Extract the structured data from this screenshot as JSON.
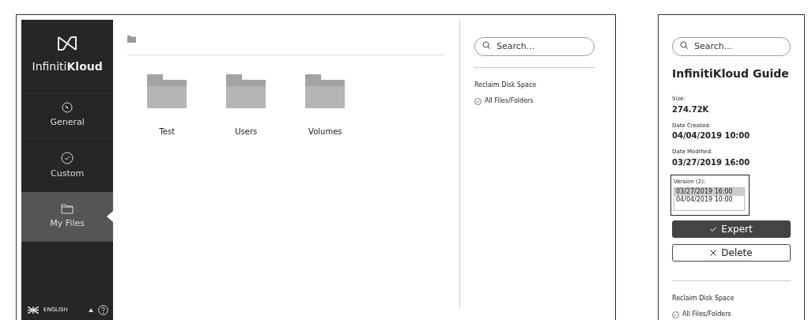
{
  "sidebar": {
    "brand": "Infiniti**Kloud**",
    "items": [
      {
        "label": "General",
        "selected": false
      },
      {
        "label": "Custom",
        "selected": false
      },
      {
        "label": "My Files",
        "selected": true
      }
    ],
    "language": "ENGLISH"
  },
  "folders": [
    {
      "name": "Test"
    },
    {
      "name": "Users"
    },
    {
      "name": "Volumes"
    }
  ],
  "side_panel": {
    "search": {
      "placeholder": "Search..."
    },
    "section": "Reclaim Disk Space",
    "option": "All Files/Folders"
  },
  "detail_panel": {
    "search": {
      "placeholder": "Search..."
    },
    "title": "InfinitiKloud Guide",
    "fields": [
      {
        "label": "Size:",
        "value": "274.72K"
      },
      {
        "label": "Date Created:",
        "value": "04/04/2019 10:00"
      },
      {
        "label": "Date Modified:",
        "value": "03/27/2019 16:00"
      }
    ],
    "versions_label": "Version (2):",
    "versions": [
      {
        "text": "03/27/2019 16:00",
        "selected": true
      },
      {
        "text": "04/04/2019 10:00",
        "selected": false
      }
    ],
    "buttons": [
      {
        "label": "Expert",
        "kind": "primary"
      },
      {
        "label": "Delete",
        "kind": "outline"
      }
    ],
    "section": "Reclaim Disk Space",
    "option": "All Files/Folders"
  }
}
